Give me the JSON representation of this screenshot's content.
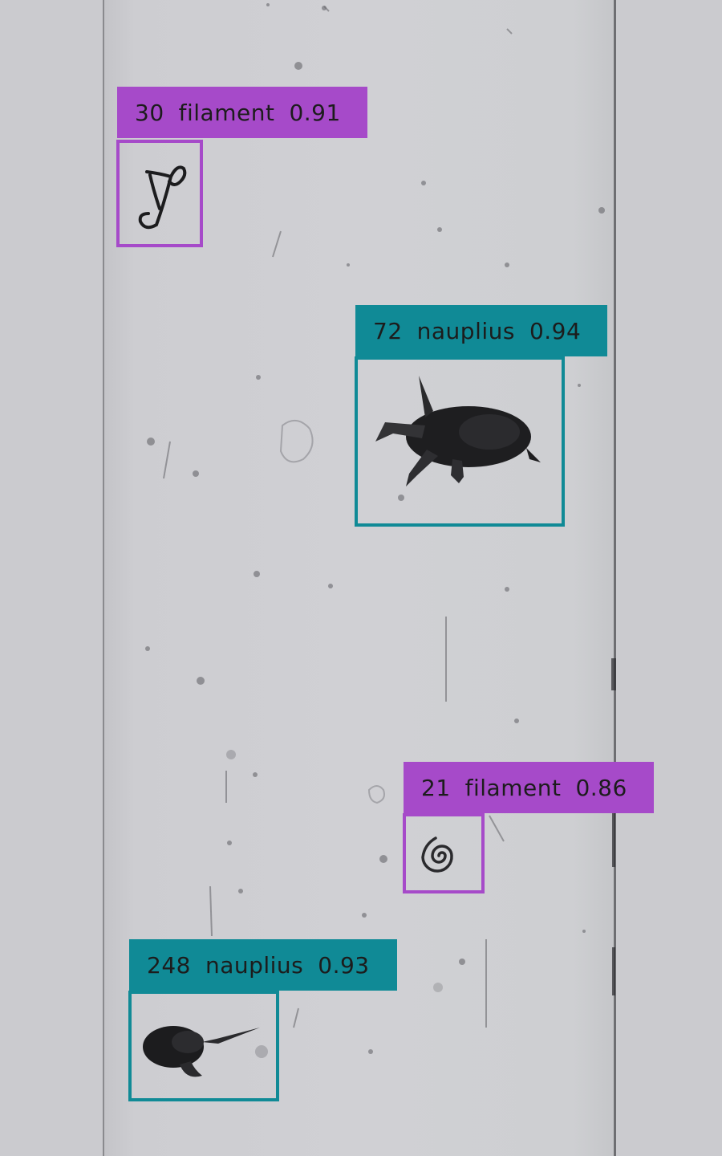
{
  "colors": {
    "filament": "#a64ac9",
    "nauplius": "#108a96",
    "background": "#cbcbcf"
  },
  "detections": [
    {
      "id": "30",
      "class": "filament",
      "score": "0.91"
    },
    {
      "id": "72",
      "class": "nauplius",
      "score": "0.94"
    },
    {
      "id": "21",
      "class": "filament",
      "score": "0.86"
    },
    {
      "id": "248",
      "class": "nauplius",
      "score": "0.93"
    }
  ]
}
